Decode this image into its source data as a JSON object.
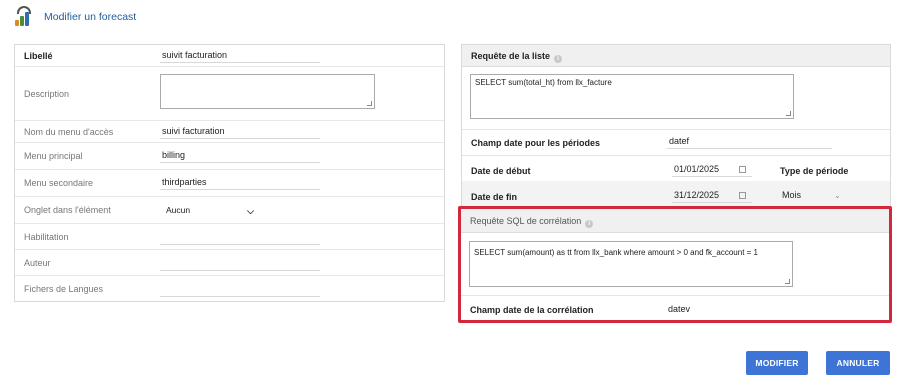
{
  "header": {
    "title": "Modifier un forecast",
    "icon": "forecast-chart-icon"
  },
  "left_form": {
    "libelle": {
      "label": "Libellé",
      "value": "suivit facturation"
    },
    "description": {
      "label": "Description",
      "value": ""
    },
    "nom_menu": {
      "label": "Nom du menu d'accès",
      "value": "suivi facturation"
    },
    "menu_principal": {
      "label": "Menu principal",
      "value": "billing"
    },
    "menu_secondaire": {
      "label": "Menu secondaire",
      "value": "thirdparties"
    },
    "onglet": {
      "label": "Onglet dans l'élément",
      "value": "Aucun"
    },
    "habilitation": {
      "label": "Habilitation",
      "value": ""
    },
    "auteur": {
      "label": "Auteur",
      "value": ""
    },
    "fichiers_langues": {
      "label": "Fichers de Langues",
      "value": ""
    }
  },
  "right_form": {
    "requete_liste": {
      "label": "Requête de la liste",
      "value": "SELECT sum(total_ht) from llx_facture"
    },
    "champ_date_periodes": {
      "label": "Champ date pour les périodes",
      "value": "datef"
    },
    "date_debut": {
      "label": "Date de début",
      "value": "01/01/2025"
    },
    "type_periode": {
      "label": "Type de période",
      "value": "Mois"
    },
    "date_fin": {
      "label": "Date de fin",
      "value": "31/12/2025"
    },
    "requete_correlation": {
      "label": "Requête SQL de corrélation",
      "value": "SELECT sum(amount) as tt from llx_bank where amount > 0 and fk_account = 1"
    },
    "champ_date_correlation": {
      "label": "Champ date de la corrélation",
      "value": "datev"
    }
  },
  "buttons": {
    "modify": "MODIFIER",
    "cancel": "ANNULER"
  },
  "colors": {
    "accent": "#3e74d6",
    "highlight": "#d1283b",
    "link": "#1f5d9c"
  }
}
